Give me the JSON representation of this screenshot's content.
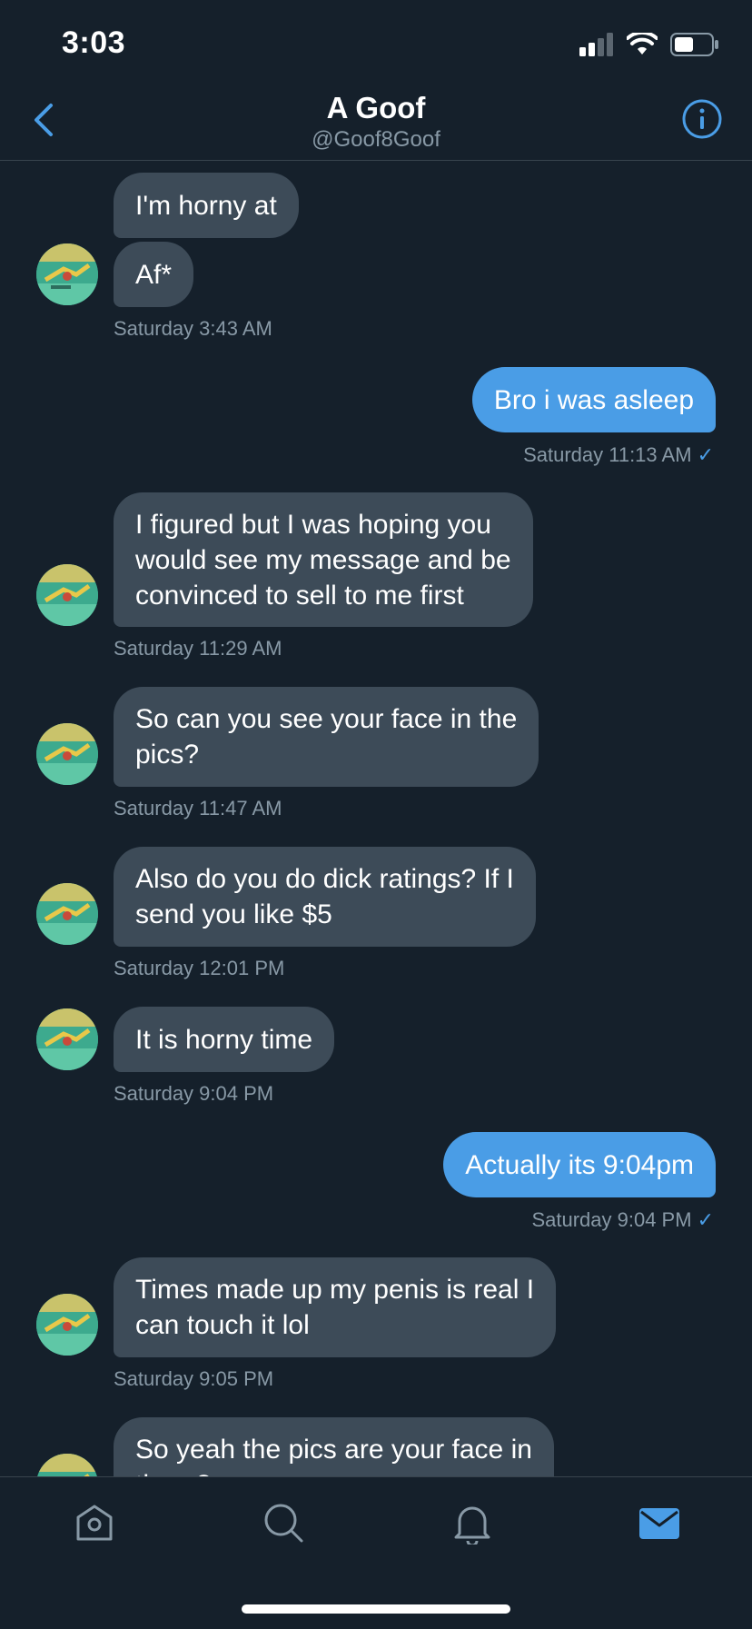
{
  "status": {
    "time": "3:03"
  },
  "header": {
    "title": "A Goof",
    "handle": "@Goof8Goof"
  },
  "messages": [
    {
      "text": "I'm horny at"
    },
    {
      "text": "Af*",
      "timestamp": "Saturday 3:43 AM"
    },
    {
      "text": "Bro i was asleep",
      "timestamp": "Saturday 11:13 AM"
    },
    {
      "text": "I figured but I was hoping you\nwould see my message and be\nconvinced to sell to me first",
      "timestamp": "Saturday 11:29 AM"
    },
    {
      "text": "So can you see your face in the\npics?",
      "timestamp": "Saturday 11:47 AM"
    },
    {
      "text": "Also do you do dick ratings? If I\nsend you like $5",
      "timestamp": "Saturday 12:01 PM"
    },
    {
      "text": "It is horny time",
      "timestamp": "Saturday 9:04 PM"
    },
    {
      "text": "Actually its 9:04pm",
      "timestamp": "Saturday 9:04 PM"
    },
    {
      "text": "Times made up my penis is real I\ncan touch it lol",
      "timestamp": "Saturday 9:05 PM"
    },
    {
      "text": "So yeah the pics are your face in\nthem?"
    }
  ],
  "read_mark": "✓",
  "colors": {
    "background": "#15202B",
    "incoming_bubble": "#3D4B58",
    "outgoing_bubble": "#4A9DE6",
    "accent": "#4A9DE6",
    "muted_text": "#8899A6"
  },
  "icons": [
    "back-chevron-icon",
    "info-icon",
    "home-icon",
    "search-icon",
    "bell-icon",
    "mail-icon"
  ]
}
